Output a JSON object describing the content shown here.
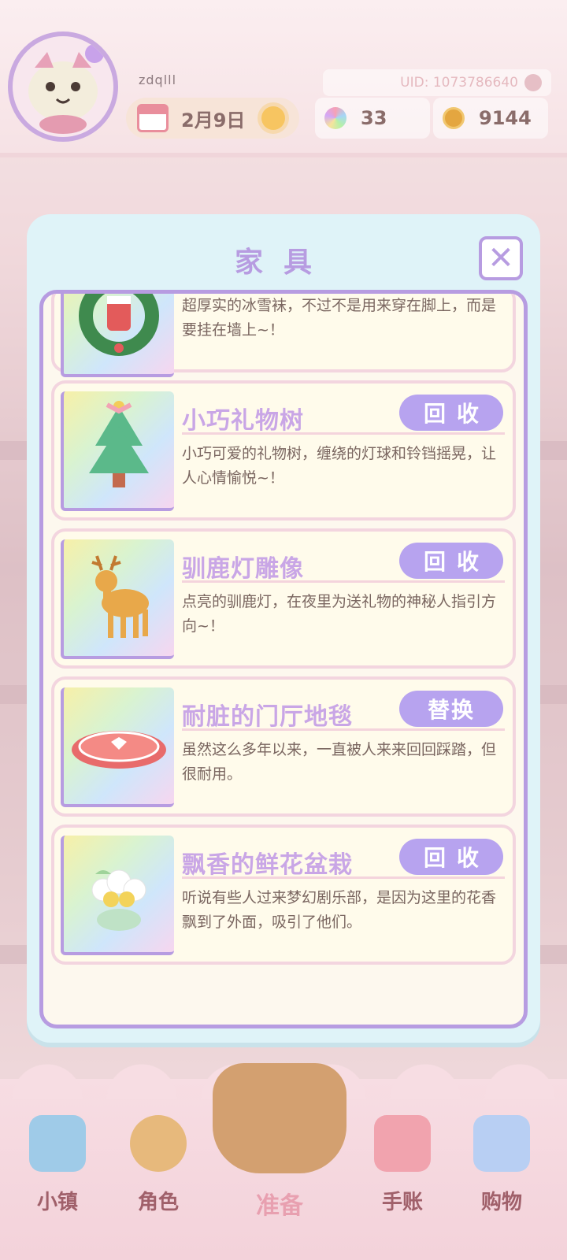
{
  "header": {
    "username": "zdqlll",
    "uid": "UID: 1073786640",
    "date": "2月9日",
    "gems": "33",
    "coins": "9144"
  },
  "modal": {
    "title": "家具",
    "close_label": "✕",
    "items": [
      {
        "name": "",
        "button": "",
        "desc": "超厚实的冰雪袜，不过不是用来穿在脚上，而是要挂在墙上~！",
        "icon": "wreath-stocking-icon"
      },
      {
        "name": "小巧礼物树",
        "button": "回收",
        "desc": "小巧可爱的礼物树，缠绕的灯球和铃铛摇晃，让人心情愉悦~！",
        "icon": "christmas-tree-icon"
      },
      {
        "name": "驯鹿灯雕像",
        "button": "回收",
        "desc": "点亮的驯鹿灯，在夜里为送礼物的神秘人指引方向~！",
        "icon": "reindeer-icon"
      },
      {
        "name": "耐脏的门厅地毯",
        "button": "替换",
        "desc": "虽然这么多年以来，一直被人来来回回踩踏，但很耐用。",
        "icon": "rug-icon"
      },
      {
        "name": "飘香的鲜花盆栽",
        "button": "回收",
        "desc": "听说有些人过来梦幻剧乐部，是因为这里的花香飘到了外面，吸引了他们。",
        "icon": "flower-pot-icon"
      }
    ]
  },
  "nav": {
    "items": [
      {
        "label": "小镇",
        "icon": "map-icon"
      },
      {
        "label": "角色",
        "icon": "character-icon"
      },
      {
        "label": "准备",
        "icon": "basket-icon"
      },
      {
        "label": "手账",
        "icon": "journal-icon"
      },
      {
        "label": "购物",
        "icon": "shopping-bag-icon"
      }
    ]
  },
  "colors": {
    "accent_purple": "#b79ce1",
    "button_purple": "#b7a3ef",
    "modal_bg": "#dff3f8",
    "card_bg": "#fffbeb"
  }
}
